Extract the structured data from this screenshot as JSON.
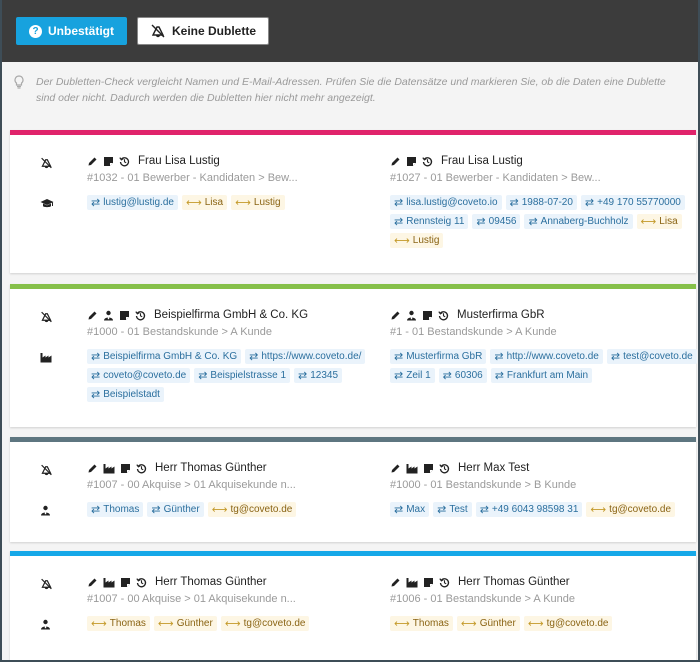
{
  "toolbar": {
    "unconfirmed_label": "Unbestätigt",
    "no_duplicate_label": "Keine Dublette"
  },
  "info_text": "Der Dubletten-Check vergleicht Namen und E-Mail-Adressen. Prüfen Sie die Datensätze und markieren Sie, ob die Daten eine Dublette sind oder nicht. Dadurch werden die Dubletten hier nicht mehr angezeigt.",
  "colors": {
    "primary": "#17a2de",
    "card1": "#e0236b",
    "card2": "#86c04a",
    "card3": "#5e7680",
    "card4": "#16a8e8"
  },
  "cards": [
    {
      "type_icon": "graduation-cap-icon",
      "left": {
        "icons": [
          "pencil-icon",
          "note-icon",
          "history-icon"
        ],
        "name": "Frau Lisa Lustig",
        "sub": "#1032 - 01 Bewerber - Kandidaten > Bew...",
        "tags": [
          {
            "kind": "eq",
            "text": "lustig@lustig.de"
          },
          {
            "kind": "ne",
            "text": "Lisa"
          },
          {
            "kind": "ne",
            "text": "Lustig"
          }
        ]
      },
      "right": {
        "icons": [
          "pencil-icon",
          "note-icon",
          "history-icon"
        ],
        "name": "Frau Lisa Lustig",
        "sub": "#1027 - 01 Bewerber - Kandidaten > Bew...",
        "tags": [
          {
            "kind": "eq",
            "text": "lisa.lustig@coveto.io"
          },
          {
            "kind": "eq",
            "text": "1988-07-20"
          },
          {
            "kind": "eq",
            "text": "+49 170 55770000"
          },
          {
            "kind": "eq",
            "text": "Rennsteig 11"
          },
          {
            "kind": "eq",
            "text": "09456"
          },
          {
            "kind": "eq",
            "text": "Annaberg-Buchholz"
          },
          {
            "kind": "ne",
            "text": "Lisa"
          },
          {
            "kind": "ne",
            "text": "Lustig"
          }
        ]
      }
    },
    {
      "type_icon": "factory-icon",
      "left": {
        "icons": [
          "pencil-icon",
          "contact-person-icon",
          "note-icon",
          "history-icon"
        ],
        "name": "Beispielfirma GmbH & Co. KG",
        "sub": "#1000 - 01 Bestandskunde > A Kunde",
        "tags": [
          {
            "kind": "eq",
            "text": "Beispielfirma GmbH & Co. KG"
          },
          {
            "kind": "eq",
            "text": "https://www.coveto.de/"
          },
          {
            "kind": "eq",
            "text": "coveto@coveto.de"
          },
          {
            "kind": "eq",
            "text": "Beispielstrasse 1"
          },
          {
            "kind": "eq",
            "text": "12345"
          },
          {
            "kind": "eq",
            "text": "Beispielstadt"
          }
        ]
      },
      "right": {
        "icons": [
          "pencil-icon",
          "contact-person-icon",
          "note-icon",
          "history-icon"
        ],
        "name": "Musterfirma GbR",
        "sub": "#1 - 01 Bestandskunde > A Kunde",
        "tags": [
          {
            "kind": "eq",
            "text": "Musterfirma GbR"
          },
          {
            "kind": "eq",
            "text": "http://www.coveto.de"
          },
          {
            "kind": "eq",
            "text": "test@coveto.de"
          },
          {
            "kind": "eq",
            "text": "Zeil 1"
          },
          {
            "kind": "eq",
            "text": "60306"
          },
          {
            "kind": "eq",
            "text": "Frankfurt am Main"
          }
        ]
      }
    },
    {
      "type_icon": "contact-person-icon",
      "left": {
        "icons": [
          "pencil-icon",
          "factory-icon",
          "note-icon",
          "history-icon"
        ],
        "name": "Herr Thomas Günther",
        "sub": "#1007 - 00 Akquise > 01 Akquisekunde n...",
        "tags": [
          {
            "kind": "eq",
            "text": "Thomas"
          },
          {
            "kind": "eq",
            "text": "Günther"
          },
          {
            "kind": "ne",
            "text": "tg@coveto.de"
          }
        ]
      },
      "right": {
        "icons": [
          "pencil-icon",
          "factory-icon",
          "note-icon",
          "history-icon"
        ],
        "name": "Herr Max Test",
        "sub": "#1000 - 01 Bestandskunde > B Kunde",
        "tags": [
          {
            "kind": "eq",
            "text": "Max"
          },
          {
            "kind": "eq",
            "text": "Test"
          },
          {
            "kind": "eq",
            "text": "+49 6043 98598 31"
          },
          {
            "kind": "ne",
            "text": "tg@coveto.de"
          }
        ]
      }
    },
    {
      "type_icon": "contact-person-icon",
      "left": {
        "icons": [
          "pencil-icon",
          "factory-icon",
          "note-icon",
          "history-icon"
        ],
        "name": "Herr Thomas Günther",
        "sub": "#1007 - 00 Akquise > 01 Akquisekunde n...",
        "tags": [
          {
            "kind": "ne",
            "text": "Thomas"
          },
          {
            "kind": "ne",
            "text": "Günther"
          },
          {
            "kind": "ne",
            "text": "tg@coveto.de"
          }
        ]
      },
      "right": {
        "icons": [
          "pencil-icon",
          "factory-icon",
          "note-icon",
          "history-icon"
        ],
        "name": "Herr Thomas Günther",
        "sub": "#1006 - 01 Bestandskunde > A Kunde",
        "tags": [
          {
            "kind": "ne",
            "text": "Thomas"
          },
          {
            "kind": "ne",
            "text": "Günther"
          },
          {
            "kind": "ne",
            "text": "tg@coveto.de"
          }
        ]
      }
    }
  ]
}
